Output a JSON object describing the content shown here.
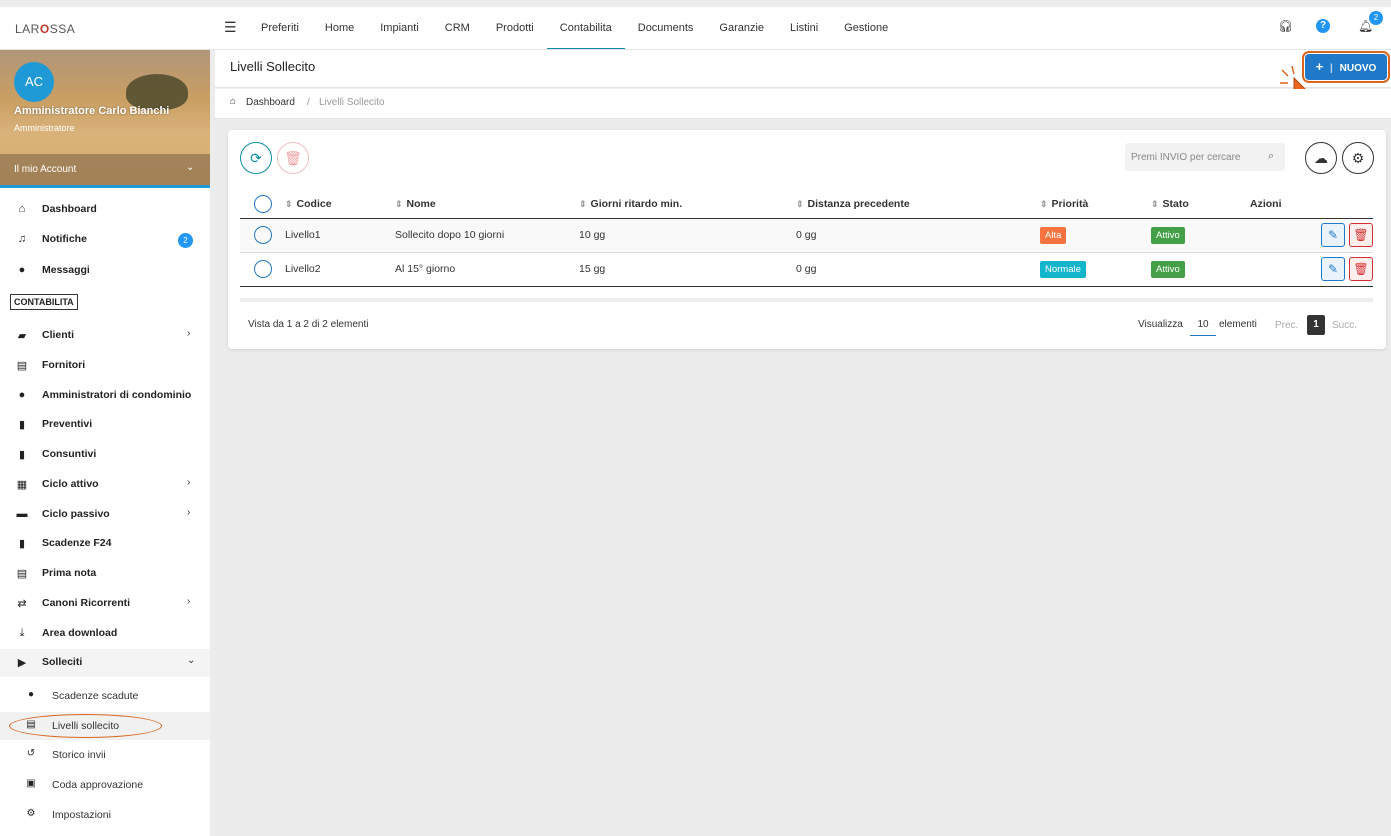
{
  "topbar": {
    "logo": "LAROSSA",
    "nav": [
      "Preferiti",
      "Home",
      "Impianti",
      "CRM",
      "Prodotti",
      "Contabilita",
      "Documents",
      "Garanzie",
      "Listini",
      "Gestione"
    ],
    "active": "Contabilita",
    "help_label": "?",
    "notif_count": "2"
  },
  "user": {
    "initials": "AC",
    "name": "Amministratore Carlo Bianchi",
    "role": "Amministratore",
    "account_label": "Il mio Account"
  },
  "sidebar": {
    "top": [
      {
        "label": "Dashboard",
        "icon": "home-icon"
      },
      {
        "label": "Notifiche",
        "icon": "bell-icon",
        "badge": "2"
      },
      {
        "label": "Messaggi",
        "icon": "chat-icon"
      }
    ],
    "section": "CONTABILITA",
    "items": [
      {
        "label": "Clienti",
        "icon": "briefcase-icon",
        "chevron": true
      },
      {
        "label": "Fornitori",
        "icon": "building-icon"
      },
      {
        "label": "Amministratori di condominio",
        "icon": "person-icon"
      },
      {
        "label": "Preventivi",
        "icon": "document-icon"
      },
      {
        "label": "Consuntivi",
        "icon": "document-icon"
      },
      {
        "label": "Ciclo attivo",
        "icon": "money-icon",
        "chevron": true
      },
      {
        "label": "Ciclo passivo",
        "icon": "cash-register-icon",
        "chevron": true
      },
      {
        "label": "Scadenze F24",
        "icon": "file-icon"
      },
      {
        "label": "Prima nota",
        "icon": "ledger-icon"
      },
      {
        "label": "Canoni Ricorrenti",
        "icon": "repeat-icon",
        "chevron": true
      },
      {
        "label": "Area download",
        "icon": "download-icon"
      },
      {
        "label": "Solleciti",
        "icon": "reminder-icon",
        "chevron": "down"
      }
    ],
    "sub": [
      {
        "label": "Scadenze scadute",
        "icon": "alert-icon"
      },
      {
        "label": "Livelli sollecito",
        "icon": "list-icon"
      },
      {
        "label": "Storico invii",
        "icon": "history-icon"
      },
      {
        "label": "Coda approvazione",
        "icon": "queue-icon"
      },
      {
        "label": "Impostazioni",
        "icon": "gear-icon"
      }
    ]
  },
  "page": {
    "title": "Livelli Sollecito",
    "new_button": "NUOVO",
    "breadcrumb": [
      "Dashboard",
      "Livelli Sollecito"
    ]
  },
  "toolbar": {
    "search_placeholder": "Premi INVIO per cercare"
  },
  "table": {
    "columns": [
      "Codice",
      "Nome",
      "Giorni ritardo min.",
      "Distanza precedente",
      "Priorità",
      "Stato",
      "Azioni"
    ],
    "rows": [
      {
        "codice": "Livello1",
        "nome": "Sollecito dopo 10 giorni",
        "giorni": "10 gg",
        "distanza": "0 gg",
        "priorita": "Alta",
        "priorita_color": "#f4733e",
        "stato": "Attivo",
        "stato_color": "#43a047"
      },
      {
        "codice": "Livello2",
        "nome": "Al 15° giorno",
        "giorni": "15 gg",
        "distanza": "0 gg",
        "priorita": "Normale",
        "priorita_color": "#12b5cb",
        "stato": "Attivo",
        "stato_color": "#43a047"
      }
    ]
  },
  "footer": {
    "info": "Vista da 1 a 2 di 2 elementi",
    "show_label": "Visualizza",
    "page_size": "10",
    "elements_label": "elementi",
    "prev": "Prec.",
    "current_page": "1",
    "next": "Succ."
  }
}
